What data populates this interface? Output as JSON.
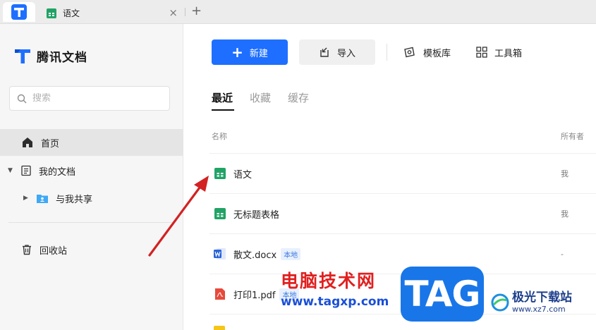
{
  "tabbar": {
    "tab_title": "语文",
    "close_glyph": "×",
    "add_glyph": "+"
  },
  "sidebar": {
    "brand": "腾讯文档",
    "search_placeholder": "搜索",
    "items": {
      "home": "首页",
      "my_docs": "我的文档",
      "shared": "与我共享",
      "trash": "回收站"
    }
  },
  "toolbar": {
    "new_label": "新建",
    "import_label": "导入",
    "template_label": "模板库",
    "tools_label": "工具箱"
  },
  "tabs": {
    "recent": "最近",
    "favorites": "收藏",
    "cache": "缓存"
  },
  "columns": {
    "name": "名称",
    "owner": "所有者"
  },
  "rows": [
    {
      "name": "语文",
      "owner": "我",
      "badge": "",
      "icon": "sheet-icon"
    },
    {
      "name": "无标题表格",
      "owner": "我",
      "badge": "",
      "icon": "sheet-icon"
    },
    {
      "name": "散文.docx",
      "owner": "-",
      "badge": "本地",
      "icon": "word-icon"
    },
    {
      "name": "打印1.pdf",
      "owner": "-",
      "badge": "本地",
      "icon": "pdf-icon"
    }
  ],
  "watermarks": {
    "site_title": "电脑技术网",
    "site_url": "www.tagxp.com",
    "tag": "TAG",
    "xz_name": "极光下载站",
    "xz_url": "www.xz7.com"
  },
  "colors": {
    "accent": "#1e6fff",
    "sheet_green": "#21a366",
    "word_blue": "#2b63d9",
    "pdf_red": "#e64a3b",
    "arrow_red": "#d22222"
  }
}
